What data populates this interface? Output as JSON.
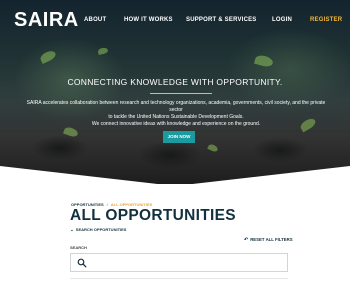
{
  "brand": {
    "logo_text": "SAIRA"
  },
  "nav": {
    "about": "ABOUT",
    "how_it_works": "HOW IT WORKS",
    "support": "SUPPORT & SERVICES",
    "login": "LOGIN",
    "register": "REGISTER"
  },
  "hero": {
    "headline": "CONNECTING KNOWLEDGE WITH OPPORTUNITY.",
    "description_line1": "SAIRA accelerates collaboration between research and technology organizations, academia, governments, civil society, and the private sector",
    "description_line2": "to tackle the United Nations Sustainable Development Goals.",
    "description_line3": "We connect innovative ideas with knowledge and experience on the ground.",
    "cta": "JOIN NOW"
  },
  "breadcrumb": {
    "root": "OPPORTUNITIES",
    "separator": "/",
    "current": "ALL OPPORTUNITIES"
  },
  "page": {
    "title": "ALL OPPORTUNITIES",
    "search_toggle": "SEARCH OPPORTUNITIES",
    "reset_filters": "RESET ALL FILTERS",
    "search_label": "SEARCH"
  },
  "colors": {
    "accent": "#f5b833",
    "teal": "#1b9aa0",
    "navy": "#12303d"
  },
  "icons": {
    "toggle": "chevron-down-icon",
    "reset": "undo-icon",
    "search": "search-icon"
  }
}
